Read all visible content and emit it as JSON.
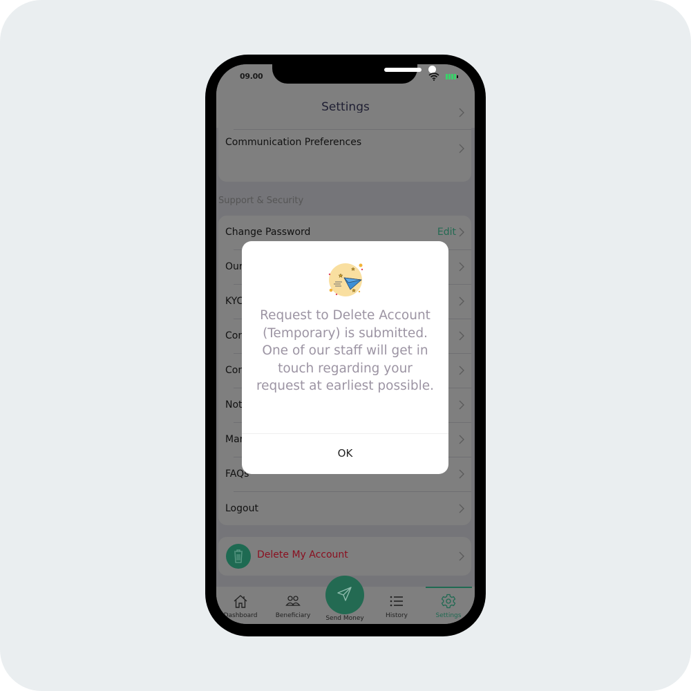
{
  "status_bar": {
    "time": "09.00",
    "wifi_icon": "wifi-icon",
    "battery_icon": "battery-icon",
    "battery_color": "#3ad26a"
  },
  "header": {
    "title": "Settings"
  },
  "preferences_card": {
    "items": [
      {
        "label": "",
        "icon": "chevron-right-icon"
      },
      {
        "label": "Communication Preferences",
        "icon": "chevron-right-icon"
      }
    ]
  },
  "support_security": {
    "section_label": "Support & Security",
    "items": [
      {
        "label": "Change Password",
        "action": "Edit"
      },
      {
        "label": "Our"
      },
      {
        "label": "KYC"
      },
      {
        "label": "Con"
      },
      {
        "label": "Con"
      },
      {
        "label": "Not"
      },
      {
        "label": "Mar"
      },
      {
        "label": "FAQs"
      },
      {
        "label": "Logout"
      }
    ]
  },
  "delete_account": {
    "label": "Delete My Account",
    "icon": "trash-icon",
    "label_color": "#8a1020"
  },
  "tabbar": {
    "tabs": [
      {
        "label": "Dashboard",
        "icon": "home-icon"
      },
      {
        "label": "Beneficiary",
        "icon": "users-icon"
      },
      {
        "label": "Send Money",
        "icon": "paper-plane-icon"
      },
      {
        "label": "History",
        "icon": "list-icon"
      },
      {
        "label": "Settings",
        "icon": "gear-icon",
        "active": true
      }
    ],
    "accent_color": "#1f6a52"
  },
  "dialog": {
    "illustration": "paper-plane-illustration",
    "message": "Request to Delete Account (Temporary) is submitted. One of our staff will get in touch regarding your request at earliest possible.",
    "ok_label": "OK"
  }
}
